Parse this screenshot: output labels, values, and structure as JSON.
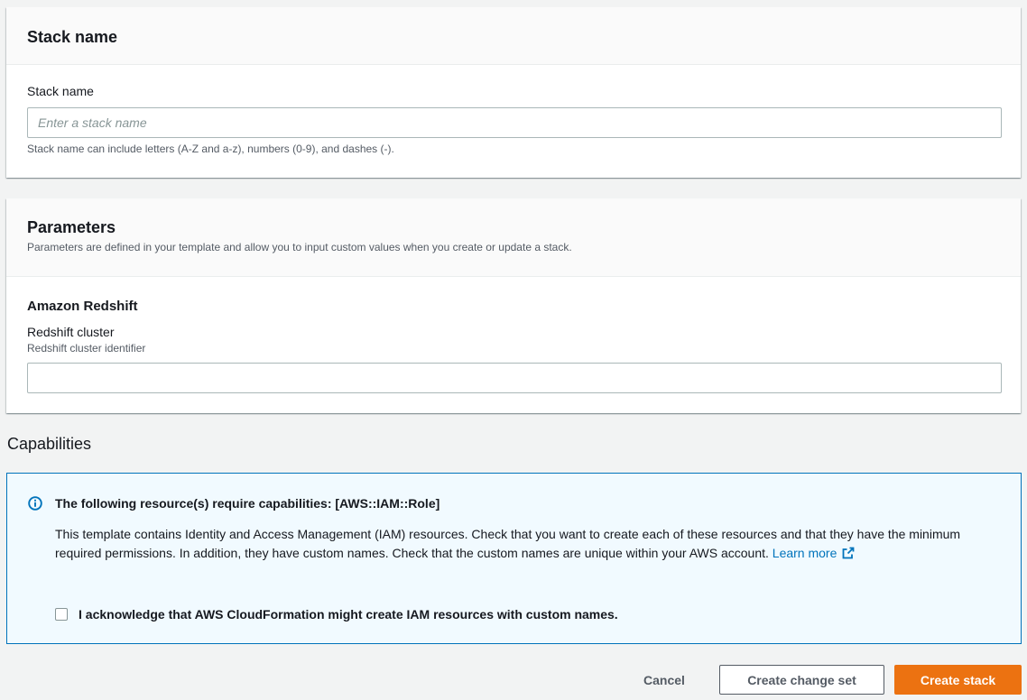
{
  "stack_name_section": {
    "heading": "Stack name",
    "field_label": "Stack name",
    "placeholder": "Enter a stack name",
    "value": "",
    "hint": "Stack name can include letters (A-Z and a-z), numbers (0-9), and dashes (-)."
  },
  "parameters_section": {
    "heading": "Parameters",
    "description": "Parameters are defined in your template and allow you to input custom values when you create or update a stack.",
    "group_title": "Amazon Redshift",
    "field_label": "Redshift cluster",
    "field_description": "Redshift cluster identifier",
    "value": ""
  },
  "capabilities": {
    "heading": "Capabilities",
    "alert_title": "The following resource(s) require capabilities: [AWS::IAM::Role]",
    "alert_body": "This template contains Identity and Access Management (IAM) resources. Check that you want to create each of these resources and that they have the minimum required permissions. In addition, they have custom names. Check that the custom names are unique within your AWS account.",
    "learn_more": "Learn more",
    "acknowledge_label": "I acknowledge that AWS CloudFormation might create IAM resources with custom names.",
    "acknowledged": false,
    "icons": {
      "info": "info-icon",
      "external": "external-link-icon"
    }
  },
  "actions": {
    "cancel": "Cancel",
    "create_change_set": "Create change set",
    "create_stack": "Create stack"
  },
  "colors": {
    "primary_button": "#ec7211",
    "link": "#0073bb",
    "alert_background": "#f1faff",
    "alert_border": "#0073bb",
    "page_background": "#f2f3f3"
  }
}
